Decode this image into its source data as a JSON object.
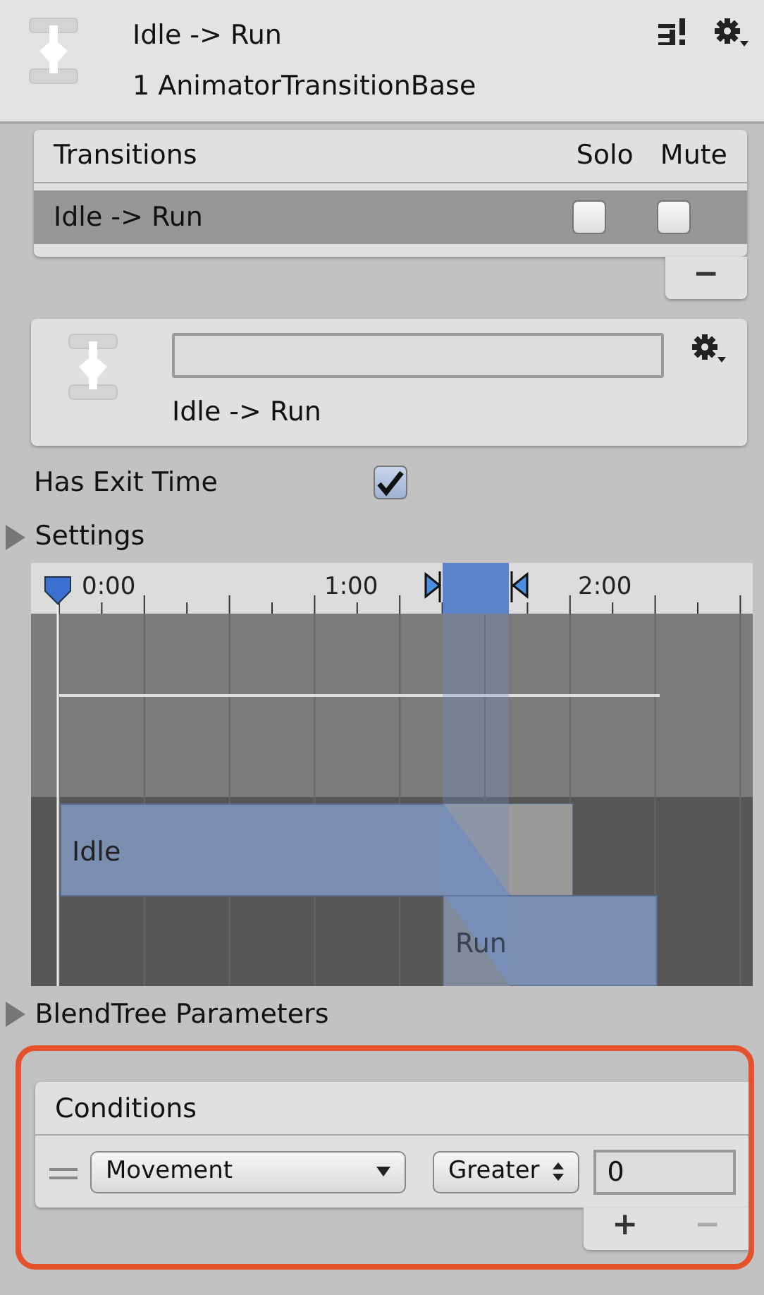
{
  "header": {
    "title": "Idle -> Run",
    "subtitle": "1 AnimatorTransitionBase"
  },
  "transitions": {
    "heading": "Transitions",
    "solo_label": "Solo",
    "mute_label": "Mute",
    "rows": [
      {
        "name": "Idle -> Run",
        "selected": true,
        "solo": false,
        "mute": false
      }
    ],
    "remove_button": "−"
  },
  "transition_detail": {
    "label": "Idle -> Run"
  },
  "has_exit_time": {
    "label": "Has Exit Time",
    "checked": true
  },
  "settings": {
    "label": "Settings",
    "expanded": false
  },
  "timeline": {
    "ticks": [
      "0:00",
      "1:00",
      "2:00"
    ],
    "clips": [
      {
        "name": "Idle"
      },
      {
        "name": "Run"
      }
    ]
  },
  "blendtree": {
    "label": "BlendTree Parameters",
    "expanded": false
  },
  "conditions": {
    "heading": "Conditions",
    "items": [
      {
        "parameter": "Movement",
        "mode": "Greater",
        "value": "0"
      }
    ],
    "add_button": "+",
    "remove_button": "−"
  }
}
